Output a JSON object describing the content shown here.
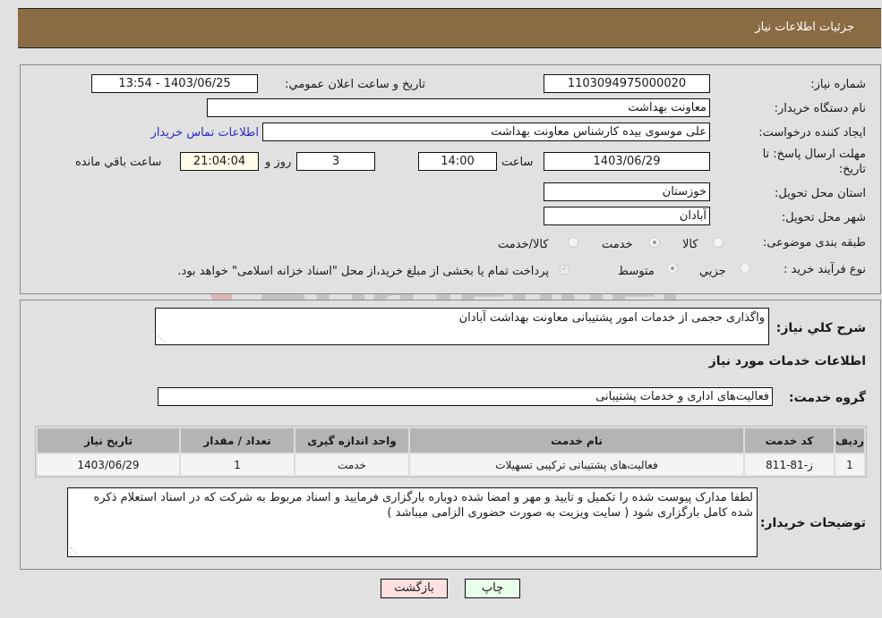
{
  "header": {
    "title": "جزئیات اطلاعات نیاز"
  },
  "form": {
    "need_number": {
      "label": "شماره نیاز:",
      "value": "1103094975000020"
    },
    "announce_datetime": {
      "label": "تاریخ و ساعت اعلان عمومي:",
      "value": "1403/06/25 - 13:54"
    },
    "buyer_org": {
      "label": "نام دستگاه خريدار:",
      "value": "معاونت بهداشت"
    },
    "requester": {
      "label": "ایجاد کننده درخواست:",
      "value": "علی موسوی بیده کارشناس معاونت بهداشت"
    },
    "buyer_contact_link": "اطلاعات تماس خريدار",
    "deadline": {
      "label": "مهلت ارسال پاسخ: تا تاریخ:",
      "date": "1403/06/29",
      "time_label": "ساعت",
      "time": "14:00",
      "days": "3",
      "days_label": "روز و",
      "remaining": "21:04:04",
      "remaining_label": "ساعت باقي مانده"
    },
    "province": {
      "label": "استان محل تحویل:",
      "value": "خوزستان"
    },
    "city": {
      "label": "شهر محل تحویل:",
      "value": "آبادان"
    },
    "category": {
      "label": "طبقه بندی موضوعی:",
      "options": [
        "کالا",
        "خدمت",
        "کالا/خدمت"
      ],
      "selected": "خدمت"
    },
    "purchase_type": {
      "label": "نوع فرآیند خرید :",
      "options": [
        "جزيي",
        "متوسط"
      ],
      "selected": "متوسط",
      "payment_note": "پرداخت تمام یا بخشی از مبلغ خرید،از محل \"اسناد خزانه اسلامی\" خواهد بود."
    }
  },
  "details": {
    "general_desc_label": "شرح کلي نياز:",
    "general_desc": "واگذاری حجمی از خدمات امور پشتیبانی معاونت بهداشت آبادان",
    "services_title": "اطلاعات خدمات مورد نياز",
    "service_group_label": "گروه خدمت:",
    "service_group": "فعالیت‌های اداری و خدمات پشتیبانی",
    "table": {
      "headers": [
        "رديف",
        "کد خدمت",
        "نام خدمت",
        "واحد اندازه گيری",
        "تعداد / مقدار",
        "تاريخ نياز"
      ],
      "rows": [
        [
          "1",
          "ز-81-811",
          "فعالیت‌های پشتیبانی ترکیبی تسهیلات",
          "خدمت",
          "1",
          "1403/06/29"
        ]
      ]
    },
    "buyer_notes_label": "توضيحات خريدار:",
    "buyer_notes": "لطفا مدارک پیوست شده را  تکمیل و تایید و مهر و امضا شده دوباره بارگزاری فرمایید و اسناد مربوط به شرکت که در اسناد استعلام ذکره شده کامل بارگزاری شود ( سایت ویزیت به صورت حضوری الزامی میباشد )"
  },
  "buttons": {
    "print": "چاپ",
    "back": "بازگشت"
  },
  "colors": {
    "header_bg": "#8b6b43",
    "link": "#2a2acd",
    "print_bg": "#eaffea",
    "back_bg": "#ffe0e0"
  },
  "watermark": "AriaTender.neT"
}
